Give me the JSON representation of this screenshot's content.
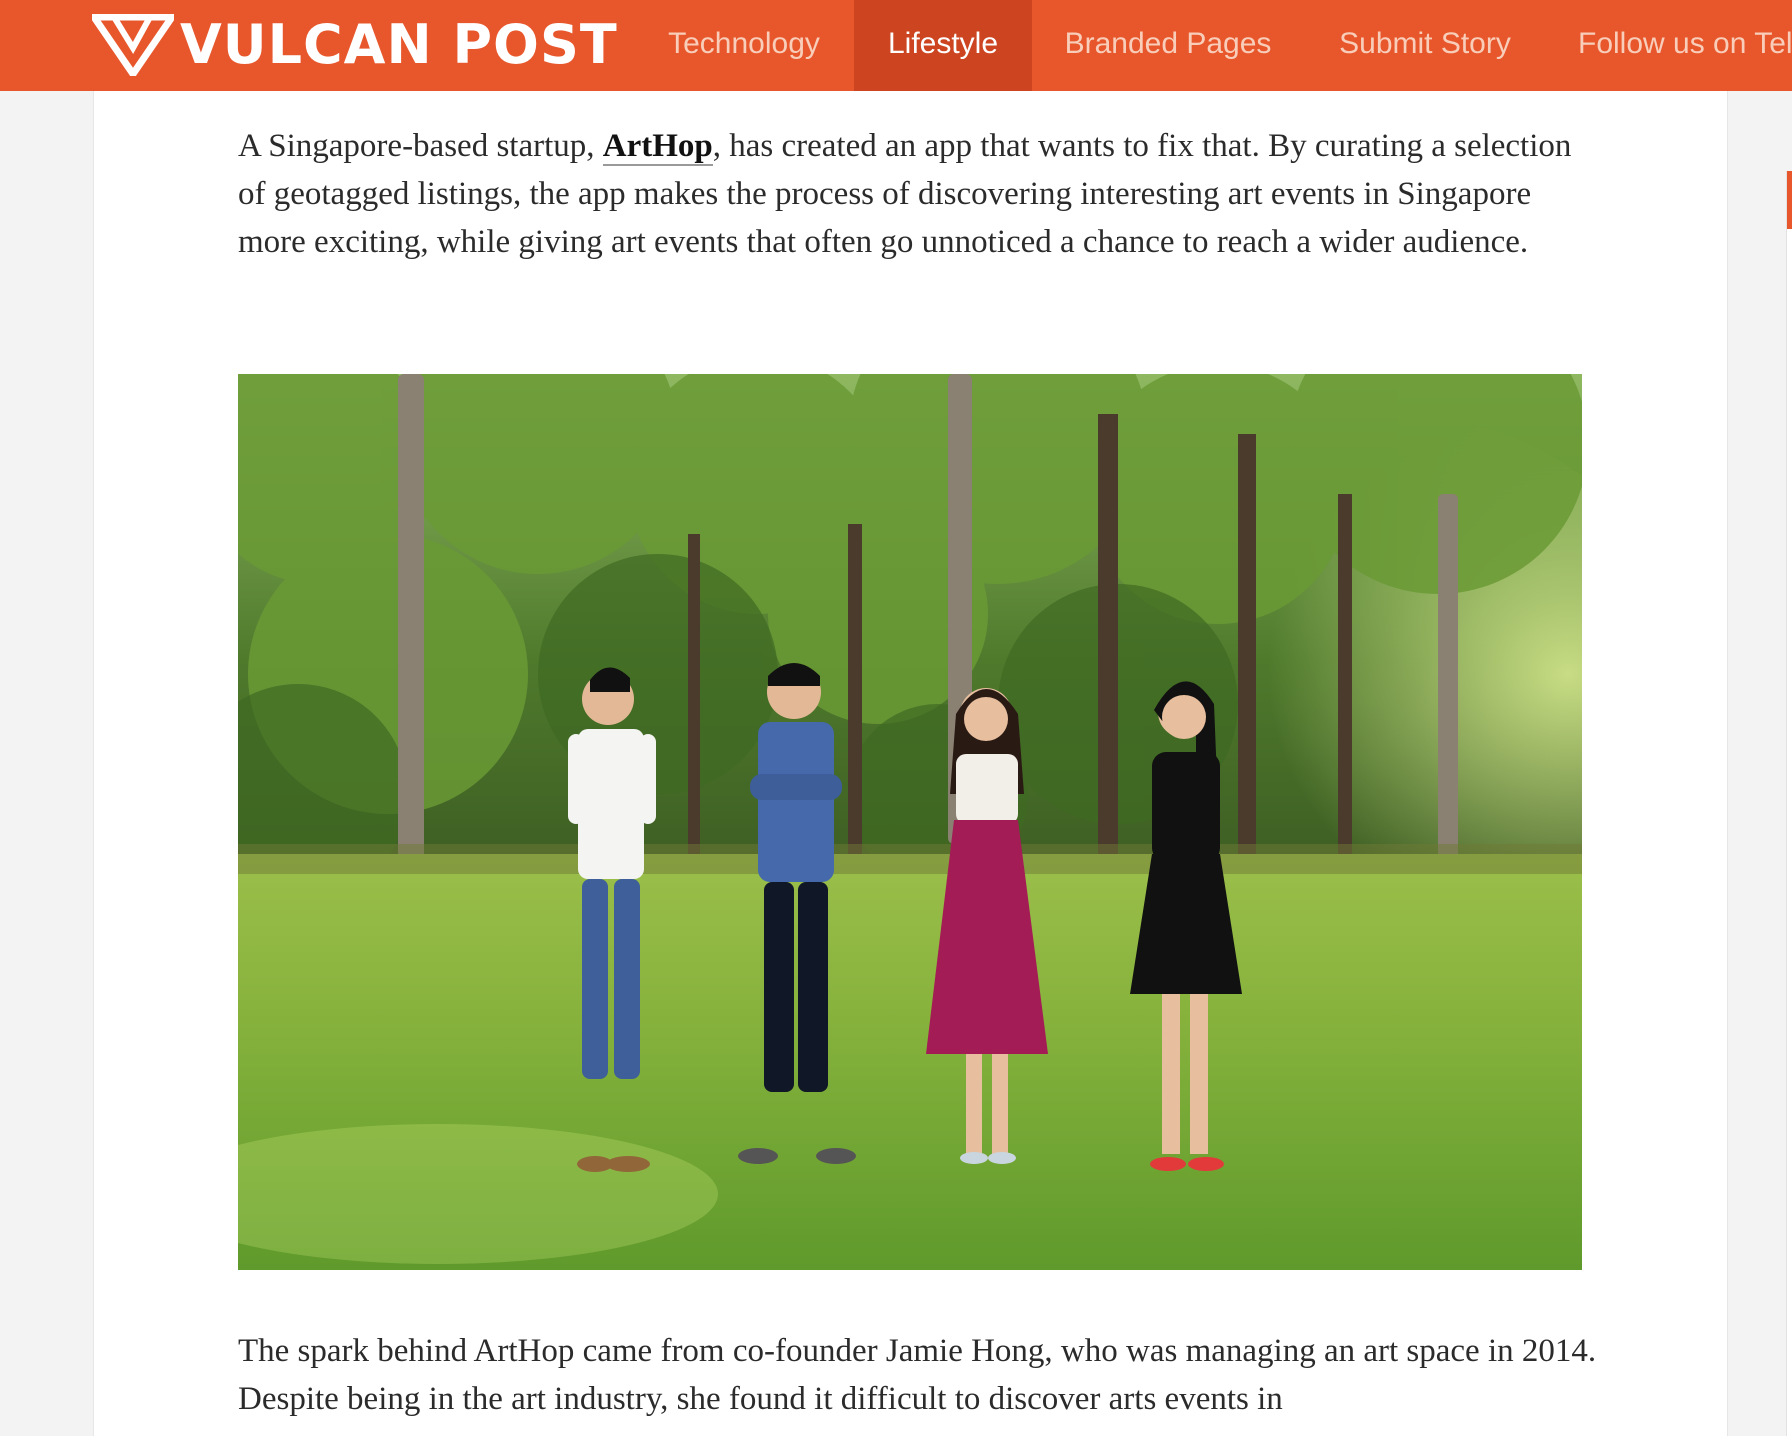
{
  "brand": {
    "name": "VULCAN POST",
    "accent_color": "#e8572c",
    "active_color": "#cc4420"
  },
  "nav": {
    "items": [
      {
        "label": "Technology",
        "active": false
      },
      {
        "label": "Lifestyle",
        "active": true
      },
      {
        "label": "Branded Pages",
        "active": false
      },
      {
        "label": "Submit Story",
        "active": false
      },
      {
        "label": "Follow us on Tel",
        "active": false
      }
    ]
  },
  "article": {
    "para1": {
      "before": "A Singapore-based startup, ",
      "link": "ArtHop",
      "after": ", has created an app that wants to fix that. By curating a selection of geotagged listings, the app makes the process of discovering interesting art events in Singapore more exciting, while giving art events that often go unnoticed a chance to reach a wider audience."
    },
    "image": {
      "description_icon": "team-photo"
    },
    "para2": "The spark behind ArtHop came from co-founder Jamie Hong, who was managing an art space in 2014. Despite being in the art industry, she found it difficult to discover arts events in"
  }
}
